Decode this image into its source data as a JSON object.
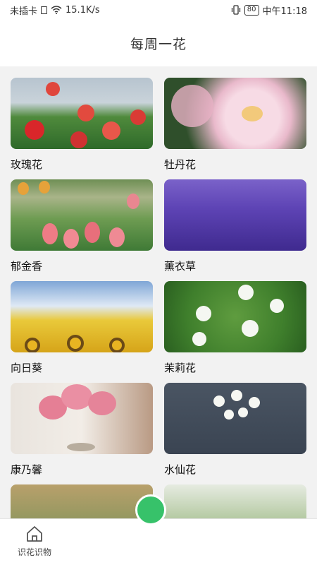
{
  "status_bar": {
    "carrier": "未插卡",
    "speed": "15.1K/s",
    "battery": "80",
    "time": "中午11:18"
  },
  "header": {
    "title": "每周一花"
  },
  "flowers": [
    {
      "name": "玫瑰花",
      "image": "rose-photo"
    },
    {
      "name": "牡丹花",
      "image": "peony-photo"
    },
    {
      "name": "郁金香",
      "image": "tulip-photo"
    },
    {
      "name": "薰衣草",
      "image": "lavender-photo"
    },
    {
      "name": "向日葵",
      "image": "sunflower-photo"
    },
    {
      "name": "茉莉花",
      "image": "jasmine-photo"
    },
    {
      "name": "康乃馨",
      "image": "carnation-photo"
    },
    {
      "name": "水仙花",
      "image": "narcissus-photo"
    }
  ],
  "tab_bar": {
    "home_label": "识花识物",
    "accent_color": "#37c26a"
  }
}
